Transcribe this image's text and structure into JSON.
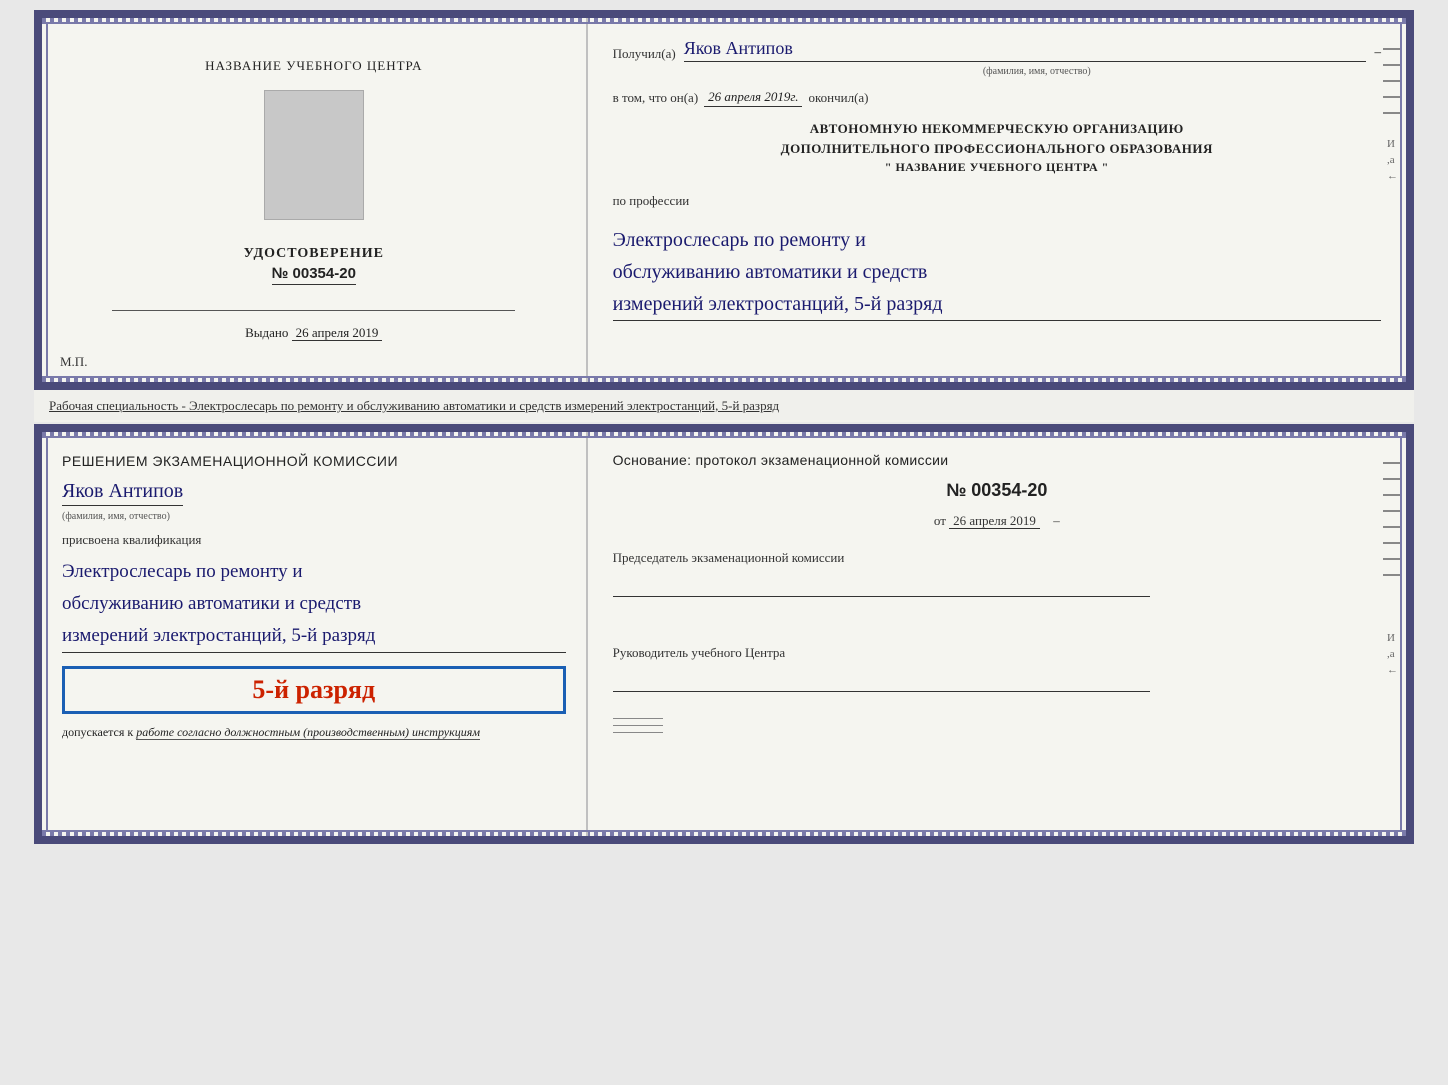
{
  "top_document": {
    "left": {
      "org_name": "НАЗВАНИЕ УЧЕБНОГО ЦЕНТРА",
      "udostoverenie_label": "УДОСТОВЕРЕНИЕ",
      "number": "№ 00354-20",
      "vydano_prefix": "Выдано",
      "vydano_date": "26 апреля 2019",
      "stamp": "М.П."
    },
    "right": {
      "poluchil_prefix": "Получил(а)",
      "recipient_name": "Яков Антипов",
      "fio_hint": "(фамилия, имя, отчество)",
      "vtom_prefix": "в том, что он(а)",
      "vtom_date": "26 апреля 2019г.",
      "okonchil": "окончил(а)",
      "org_line1": "АВТОНОМНУЮ НЕКОММЕРЧЕСКУЮ ОРГАНИЗАЦИЮ",
      "org_line2": "ДОПОЛНИТЕЛЬНОГО ПРОФЕССИОНАЛЬНОГО ОБРАЗОВАНИЯ",
      "org_line3": "\"    НАЗВАНИЕ УЧЕБНОГО ЦЕНТРА    \"",
      "po_professii": "по профессии",
      "profession_line1": "Электрослесарь по ремонту и",
      "profession_line2": "обслуживанию автоматики и средств",
      "profession_line3": "измерений электростанций, 5-й разряд"
    }
  },
  "separator": {
    "text": "Рабочая специальность - Электрослесарь по ремонту и обслуживанию автоматики и средств измерений электростанций, 5-й разряд"
  },
  "bottom_document": {
    "left": {
      "resheniem_title": "Решением  экзаменационной  комиссии",
      "person_name": "Яков Антипов",
      "fio_hint": "(фамилия, имя, отчество)",
      "prisvoyena_label": "присвоена квалификация",
      "qual_line1": "Электрослесарь по ремонту и",
      "qual_line2": "обслуживанию автоматики и средств",
      "qual_line3": "измерений электростанций, 5-й разряд",
      "razryad_badge": "5-й разряд",
      "dopuskaetsya_prefix": "допускается к",
      "dopuskaetsya_italic": "работе согласно должностным (производственным) инструкциям"
    },
    "right": {
      "osnovanie_label": "Основание: протокол экзаменационной комиссии",
      "protocol_num": "№  00354-20",
      "ot_prefix": "от",
      "ot_date": "26 апреля 2019",
      "predsedatel_label": "Председатель экзаменационной комиссии",
      "rukovoditel_label": "Руководитель учебного Центра"
    }
  }
}
